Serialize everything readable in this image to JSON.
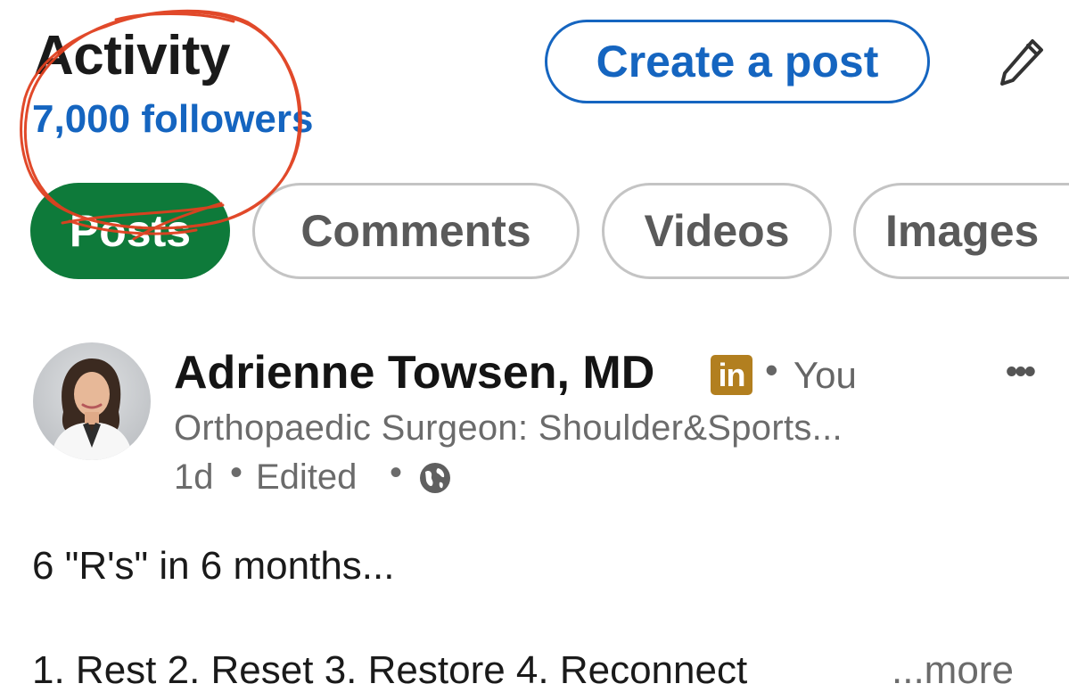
{
  "header": {
    "title": "Activity",
    "followers": "7,000 followers",
    "create_post_label": "Create a post",
    "edit_icon": "pencil-icon"
  },
  "tabs": [
    {
      "label": "Posts",
      "selected": true
    },
    {
      "label": "Comments",
      "selected": false
    },
    {
      "label": "Videos",
      "selected": false
    },
    {
      "label": "Images",
      "selected": false
    }
  ],
  "post": {
    "author": "Adrienne Towsen, MD",
    "badge": "in",
    "relation_sep": "•",
    "relation": "You",
    "headline": "Orthopaedic Surgeon: Shoulder&Sports...",
    "time": "1d",
    "sep": "•",
    "edited": "Edited",
    "visibility_icon": "globe-icon",
    "more_icon": "•••",
    "text_line1": "6 \"R's\" in 6 months...",
    "text_line2": "1. Rest 2. Reset 3. Restore 4. Reconnect",
    "see_more": "...more"
  },
  "colors": {
    "accent_blue": "#1565c0",
    "posts_tab_green": "#0e7a3a",
    "linkedin_badge": "#b27f1f",
    "annotation_red": "#e0401f"
  }
}
